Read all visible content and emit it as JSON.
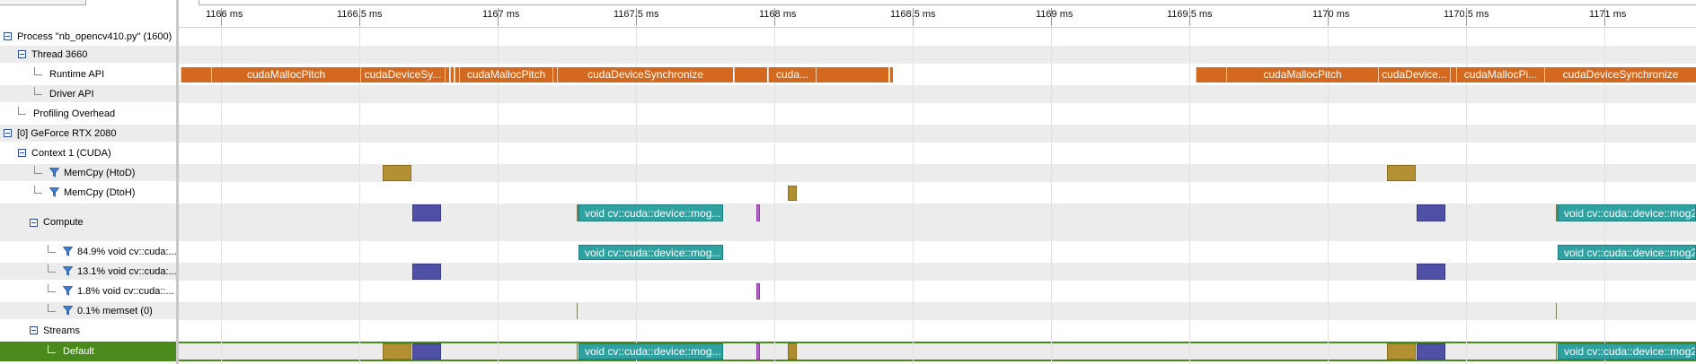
{
  "tree": {
    "rows": [
      {
        "label": "Process \"nb_opencv410.py\" (1600)",
        "kind": "toggle",
        "name": "process-row"
      },
      {
        "label": "Thread 3660",
        "kind": "toggle",
        "name": "thread-row"
      },
      {
        "label": "Runtime API",
        "kind": "leaf",
        "name": "runtime-api-row"
      },
      {
        "label": "Driver API",
        "kind": "leaf",
        "name": "driver-api-row"
      },
      {
        "label": "Profiling Overhead",
        "kind": "leaf",
        "name": "profiling-overhead-row"
      },
      {
        "label": "[0] GeForce RTX 2080",
        "kind": "toggle",
        "name": "gpu-row"
      },
      {
        "label": "Context 1 (CUDA)",
        "kind": "toggle",
        "name": "context-row"
      },
      {
        "label": "MemCpy (HtoD)",
        "kind": "filter",
        "name": "memcpy-htod-row"
      },
      {
        "label": "MemCpy (DtoH)",
        "kind": "filter",
        "name": "memcpy-dtoh-row"
      },
      {
        "label": "Compute",
        "kind": "toggle",
        "name": "compute-row"
      },
      {
        "label": "84.9% void cv::cuda:...",
        "kind": "filter",
        "name": "kernel-84-row"
      },
      {
        "label": "13.1% void cv::cuda:...",
        "kind": "filter",
        "name": "kernel-13-row"
      },
      {
        "label": "1.8% void cv::cuda::...",
        "kind": "filter",
        "name": "kernel-18-row"
      },
      {
        "label": "0.1% memset (0)",
        "kind": "filter",
        "name": "memset-row"
      },
      {
        "label": "Streams",
        "kind": "toggle",
        "name": "streams-row"
      },
      {
        "label": "Default",
        "kind": "leaf",
        "name": "default-stream-row"
      }
    ]
  },
  "ruler": {
    "ticks": [
      "1166 ms",
      "1166.5 ms",
      "1167 ms",
      "1167.5 ms",
      "1168 ms",
      "1168.5 ms",
      "1169 ms",
      "1169.5 ms",
      "1170 ms",
      "1170.5 ms",
      "1171 ms"
    ]
  },
  "timeline": {
    "runtime_api": [
      "cudaMallocPitch",
      "cudaDeviceSy...",
      "cudaMallocPitch",
      "cudaDeviceSynchronize",
      "cuda...",
      "cudaMallocPitch",
      "cudaDevice...",
      "cudaMallocPi...",
      "cudaDeviceSynchronize"
    ],
    "kernel_label": "void cv::cuda::device::mog...",
    "kernel_label_cut": "void cv::cuda::device::mog2..."
  },
  "colors": {
    "runtime_api": "#d2691e",
    "memcpy_htod": "#b39032",
    "memcpy_dtoh": "#b08d2d",
    "kernel_84_9": "#2fa1a1",
    "kernel_13_1": "#4f50a6",
    "kernel_1_8": "#b565c9",
    "selected_row": "#4a8a1c"
  },
  "icons": {
    "toggle": "collapse-minus-icon",
    "filter": "funnel-icon",
    "leaf": "tree-elbow-icon"
  }
}
